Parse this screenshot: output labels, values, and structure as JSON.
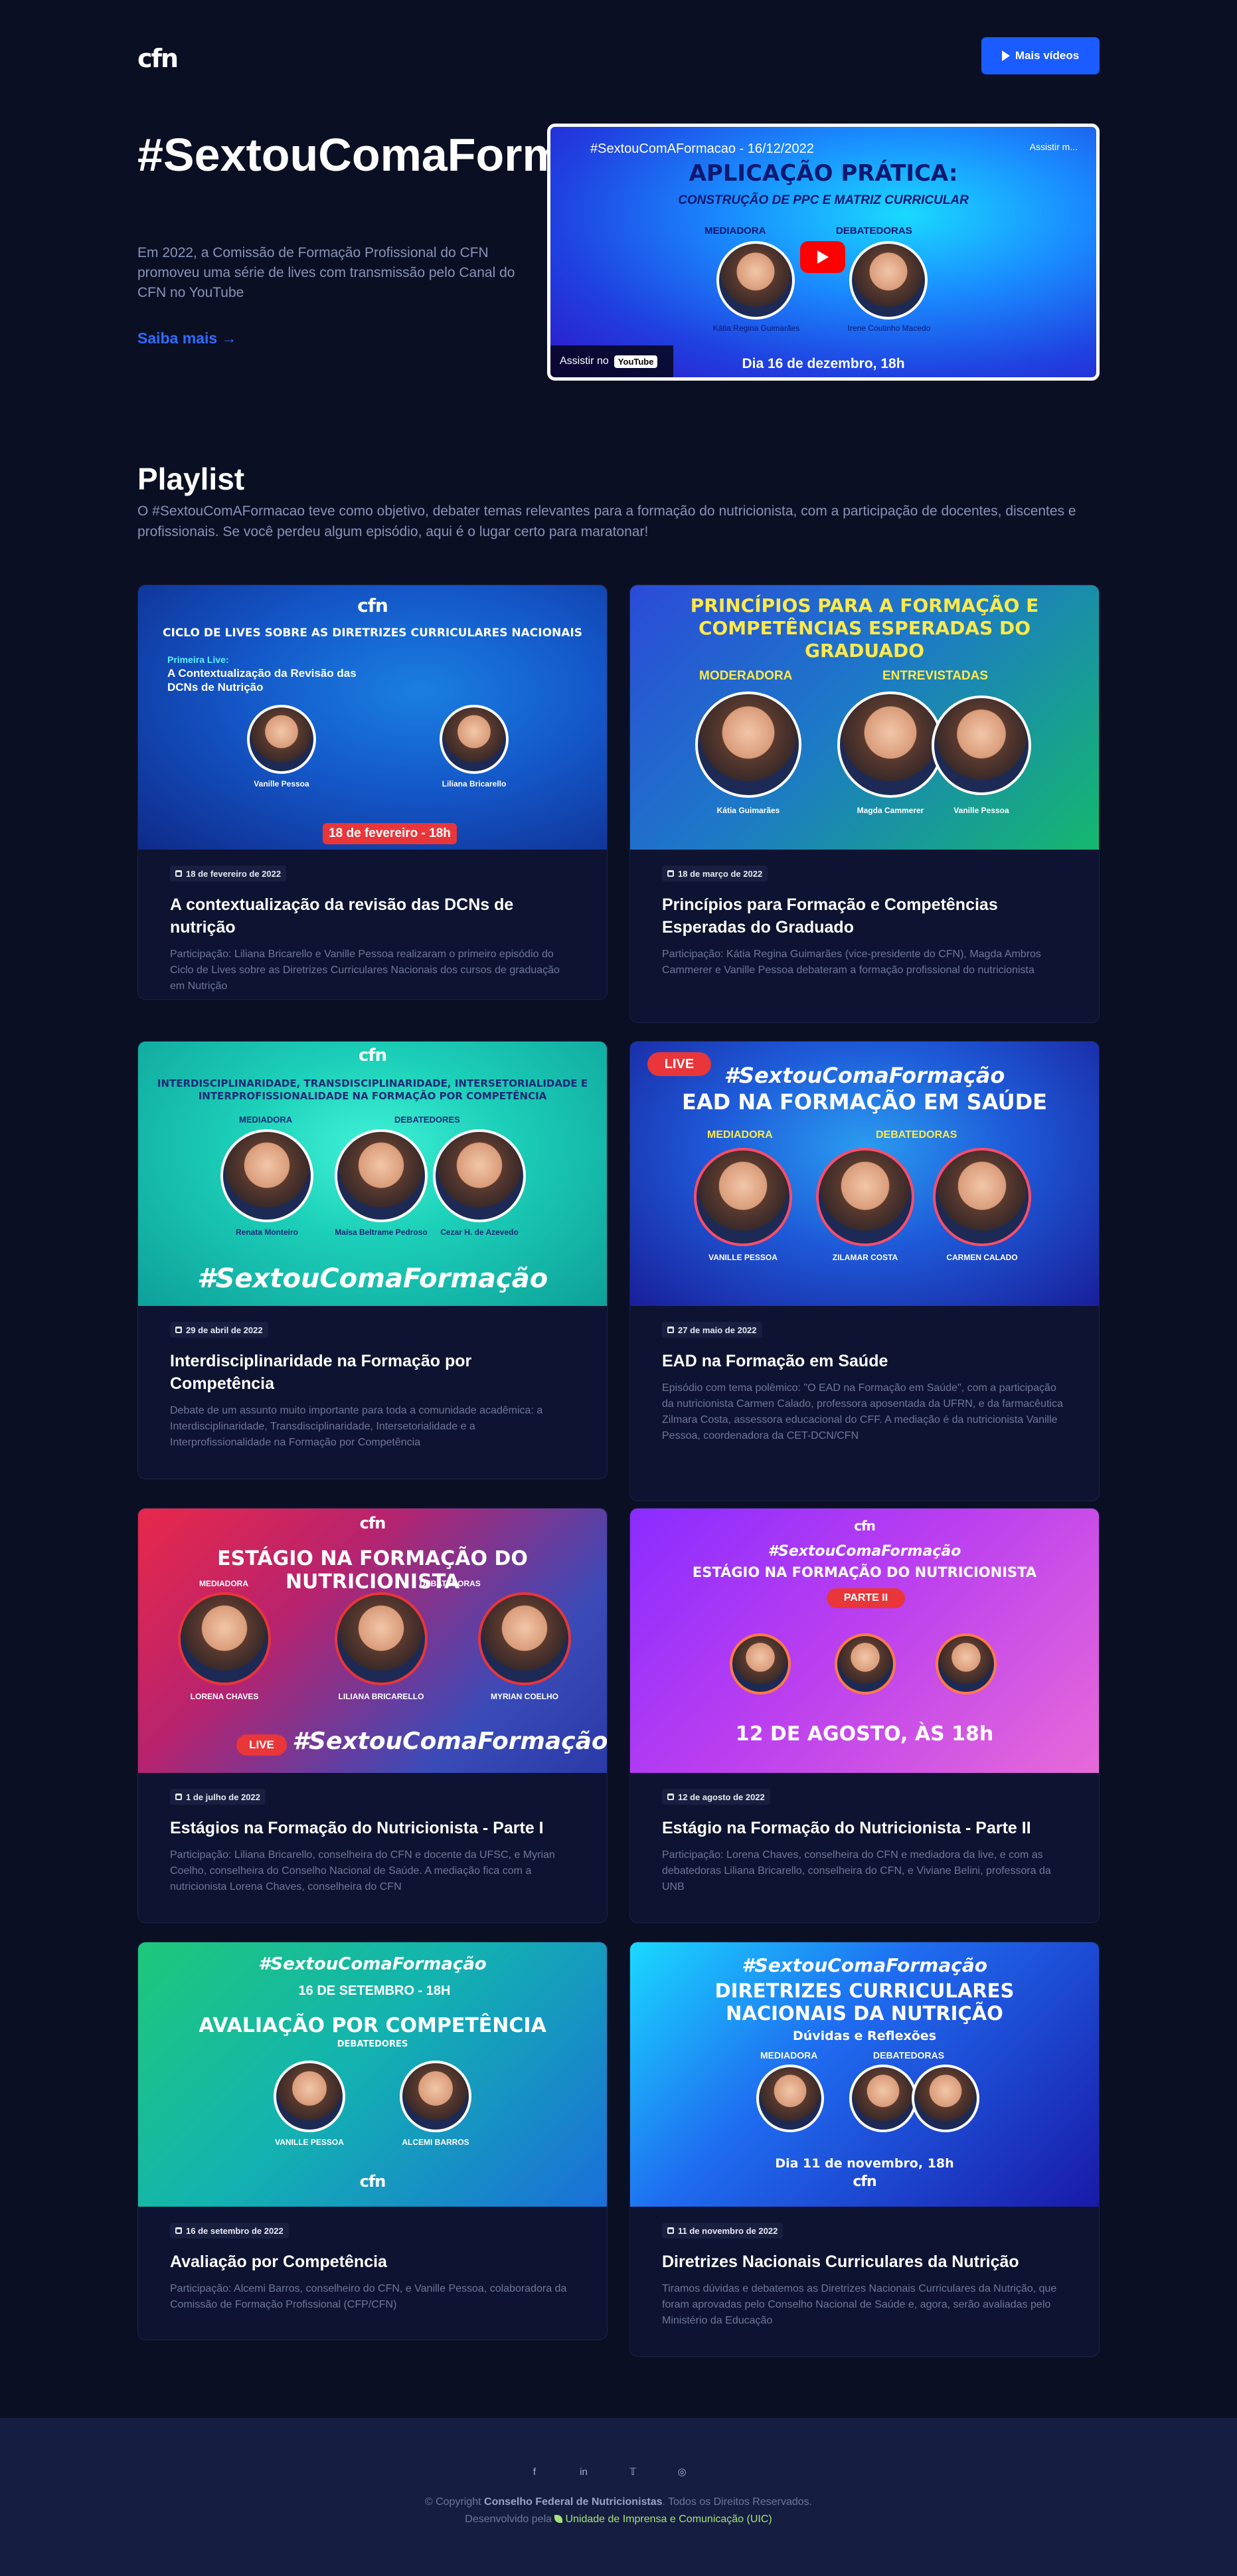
{
  "header": {
    "logo": "cfn",
    "more_videos_label": "Mais vídeos"
  },
  "hero": {
    "title": "#SextouComaFormação",
    "description": "Em 2022, a Comissão de Formação Profissional do CFN promoveu uma série de lives com transmissão pelo Canal do CFN no YouTube",
    "link_label": "Saiba mais →",
    "video": {
      "title": "#SextouComAFormacao - 16/12/2022",
      "watch_later": "Assistir m...",
      "heading": "APLICAÇÃO PRÁTICA:",
      "subheading": "CONSTRUÇÃO DE PPC E MATRIZ CURRICULAR",
      "moderator_label": "MEDIADORA",
      "debaters_label": "DEBATEDORAS",
      "moderator_name": "Kátia Regina Guimarães",
      "debater_name": "Irene Coutinho Macedo",
      "date": "Dia 16 de dezembro, 18h",
      "watch_on": "Assistir no",
      "youtube": "YouTube"
    }
  },
  "playlist": {
    "title": "Playlist",
    "description": "O #SextouComAFormacao teve como objetivo, debater temas relevantes para a formação do nutricionista, com a participação de docentes, discentes e profissionais. Se você perdeu algum episódio, aqui é o lugar certo para maratonar!",
    "items": [
      {
        "date": "18 de fevereiro de 2022",
        "title": "A contextualização da revisão das DCNs de nutrição",
        "description": "Participação: Liliana Bricarello e Vanille Pessoa realizaram o primeiro episódio do Ciclo de Lives sobre as Diretrizes Curriculares Nacionais dos cursos de graduação em Nutrição",
        "thumb": {
          "heading": "CICLO DE LIVES SOBRE AS DIRETRIZES CURRICULARES NACIONAIS",
          "sub1": "Primeira Live:",
          "sub2": "A Contextualização da Revisão das DCNs de Nutrição",
          "name1": "Vanille Pessoa",
          "name2": "Liliana Bricarello",
          "pill": "18 de fevereiro - 18h"
        }
      },
      {
        "date": "18 de março de 2022",
        "title": "Princípios para Formação e Competências Esperadas do Graduado",
        "description": "Participação: Kátia Regina Guimarães (vice-presidente do CFN), Magda Ambros Cammerer e Vanille Pessoa debateram a formação profissional do nutricionista",
        "thumb": {
          "heading": "PRINCÍPIOS PARA A FORMAÇÃO E COMPETÊNCIAS ESPERADAS DO GRADUADO",
          "role1": "MODERADORA",
          "role2": "ENTREVISTADAS",
          "name1": "Kátia Guimarães",
          "name2": "Magda Cammerer",
          "name3": "Vanille Pessoa"
        }
      },
      {
        "date": "29 de abril de 2022",
        "title": "Interdisciplinaridade na Formação por Competência",
        "description": "Debate de um assunto muito importante para toda a comunidade acadêmica: a Interdisciplinaridade, Transdisciplinaridade, Intersetorialidade e a Interprofissionalidade na Formação por Competência",
        "thumb": {
          "heading": "INTERDISCIPLINARIDADE, TRANSDISCIPLINARIDADE, INTERSETORIALIDADE E INTERPROFISSIONALIDADE NA FORMAÇÃO POR COMPETÊNCIA",
          "role1": "MEDIADORA",
          "role2": "DEBATEDORES",
          "name1": "Renata Monteiro",
          "name2": "Maísa Beltrame Pedroso",
          "name3": "Cezar H. de Azevedo",
          "tag": "#SextouComaFormação"
        }
      },
      {
        "date": "27 de maio de 2022",
        "title": "EAD na Formação em Saúde",
        "description": "Episódio com tema polêmico: \"O EAD na Formação em Saúde\", com a participação da nutricionista Carmen Calado, professora aposentada da UFRN, e da farmacêutica Zilmara Costa, assessora educacional do CFF. A mediação é da nutricionista Vanille Pessoa, coordenadora da CET-DCN/CFN",
        "thumb": {
          "live": "LIVE",
          "tag": "#SextouComaFormação",
          "heading": "EAD NA FORMAÇÃO EM SAÚDE",
          "role1": "MEDIADORA",
          "role2": "DEBATEDORAS",
          "name1": "VANILLE PESSOA",
          "name2": "ZILAMAR COSTA",
          "name3": "CARMEN CALADO"
        }
      },
      {
        "date": "1 de julho de 2022",
        "title": "Estágios na Formação do Nutricionista - Parte I",
        "description": "Participação: Liliana Bricarello, conselheira do CFN e docente da UFSC, e Myrian Coelho, conselheira do Conselho Nacional de Saúde. A mediação fica com a nutricionista Lorena Chaves, conselheira do CFN",
        "thumb": {
          "heading": "ESTÁGIO NA FORMAÇÃO DO NUTRICIONISTA",
          "role1": "MEDIADORA",
          "role2": "DEBATEDORAS",
          "name1": "LORENA CHAVES",
          "name2": "LILIANA BRICARELLO",
          "name3": "MYRIAN COELHO",
          "live": "LIVE",
          "tag": "#SextouComaFormação"
        }
      },
      {
        "date": "12 de agosto de 2022",
        "title": "Estágio na Formação do Nutricionista - Parte II",
        "description": "Participação: Lorena Chaves, conselheira do CFN e mediadora da live, e com as debatedoras Liliana Bricarello, conselheira do CFN, e Viviane Belini, professora da UNB",
        "thumb": {
          "tag": "#SextouComaFormação",
          "heading": "ESTÁGIO NA FORMAÇÃO DO NUTRICIONISTA",
          "pill": "PARTE II",
          "date_line": "12 DE AGOSTO, ÀS 18h"
        }
      },
      {
        "date": "16 de setembro de 2022",
        "title": "Avaliação por Competência",
        "description": "Participação: Alcemi Barros, conselheiro do CFN, e Vanille Pessoa, colaboradora da Comissão de Formação Profissional (CFP/CFN)",
        "thumb": {
          "tag": "#SextouComaFormação",
          "pill": "16 DE SETEMBRO - 18H",
          "heading": "AVALIAÇÃO POR COMPETÊNCIA",
          "role": "DEBATEDORES",
          "name1": "VANILLE PESSOA",
          "name2": "ALCEMI BARROS"
        }
      },
      {
        "date": "11 de novembro de 2022",
        "title": "Diretrizes Nacionais Curriculares da Nutrição",
        "description": "Tiramos dúvidas e debatemos as Diretrizes Nacionais Curriculares da Nutrição, que foram aprovadas pelo Conselho Nacional de Saúde e, agora, serão avaliadas pelo Ministério da Educação",
        "thumb": {
          "tag": "#SextouComaFormação",
          "heading": "DIRETRIZES CURRICULARES NACIONAIS DA NUTRIÇÃO",
          "sub": "Dúvidas e Reflexões",
          "role1": "MEDIADORA",
          "role2": "DEBATEDORAS",
          "date_line": "Dia 11 de novembro, 18h"
        }
      }
    ]
  },
  "footer": {
    "copyright_prefix": "© Copyright",
    "org": "Conselho Federal de Nutricionistas",
    "copyright_suffix": ". Todos os Direitos Reservados.",
    "dev_prefix": "Desenvolvido pela",
    "dev_name": "Unidade de Imprensa e Comunicação (UIC)"
  },
  "colors": {
    "background": "#0a0f23",
    "accent": "#1a5cff",
    "card": "#0d1330",
    "footer": "#151d40",
    "muted_text": "#8a93b8"
  },
  "icons": [
    "play-icon",
    "arrow-right-icon",
    "calendar-icon",
    "facebook-icon",
    "linkedin-icon",
    "twitter-icon",
    "instagram-icon"
  ]
}
